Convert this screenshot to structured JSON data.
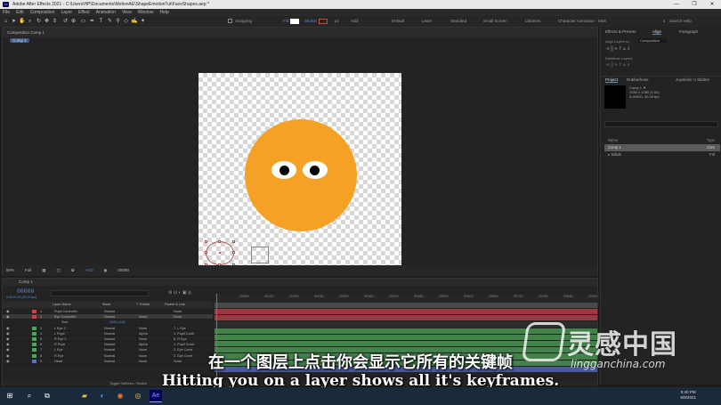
{
  "window": {
    "title": "Adobe After Effects 2021 - C:\\Users\\HP\\Documents\\MotionAE\\ShapeEmotionTut\\FaceShapes.aep *",
    "controls": [
      "—",
      "❐",
      "✕"
    ]
  },
  "menu": [
    "File",
    "Edit",
    "Composition",
    "Layer",
    "Effect",
    "Animation",
    "View",
    "Window",
    "Help"
  ],
  "toolbar": {
    "snapping_label": "Snapping",
    "fill_label": "Fill:",
    "stroke_label": "Stroke:",
    "stroke_value": "px",
    "add_label": "Add:",
    "workspaces": [
      "Default",
      "Learn",
      "Standard",
      "Small Screen",
      "Libraries",
      "Character Animation - Stub"
    ],
    "search_placeholder": "Search Help"
  },
  "composition_panel": {
    "tab_label": "Composition Comp 1",
    "breadcrumb": "Comp 1",
    "zoom": "50%",
    "resolution": "Full",
    "timecode": "00000",
    "exposure": "+0.0"
  },
  "colors": {
    "face": "#f4a125",
    "label_red": "#c8424a",
    "label_green": "#4fa35a",
    "label_blue": "#5a6ec2",
    "timecode": "#5a8cd6"
  },
  "right_panel": {
    "tabs": [
      "Effects & Presets",
      "Align",
      "Paragraph"
    ],
    "align_layers_label": "Align Layers to:",
    "align_target": "Composition",
    "distribute_label": "Distribute Layers:",
    "project_tabs": [
      "Project",
      "Rubberhose",
      "Joysticks 'n Sliders"
    ],
    "project_item": {
      "name": "Comp 1 ▼",
      "size": "1080 x 1080 (1.00)",
      "duration": "Δ 00900, 30.00 fps"
    },
    "project_columns": [
      "Name",
      "Type"
    ],
    "project_rows": [
      {
        "name": "Comp 1",
        "type": "Com"
      },
      {
        "name": "Solids",
        "type": "Fol"
      }
    ]
  },
  "timeline": {
    "tab_label": "Comp 1",
    "timecode": "00000",
    "timecode_sub": "0:00:00:00 (30.00 fps)",
    "columns": [
      "Layer Name",
      "Mode",
      "T TrkMat",
      "Parent & Link"
    ],
    "layers": [
      {
        "num": "1",
        "name": "Pupil Controller",
        "mode": "Normal",
        "trkmat": "",
        "parent": "None",
        "label": "red"
      },
      {
        "num": "2",
        "name": "Eye Controller",
        "mode": "Normal",
        "trkmat": "None",
        "parent": "None",
        "label": "red",
        "selected": true
      },
      {
        "num": "",
        "name": "Size",
        "mode": "",
        "trkmat": "",
        "parent": "",
        "label": "",
        "prop_value": "1060,1140"
      },
      {
        "num": "3",
        "name": "L Eye 2",
        "mode": "Normal",
        "trkmat": "None",
        "parent": "7. L Eye",
        "label": "green"
      },
      {
        "num": "4",
        "name": "L Pupil",
        "mode": "Normal",
        "trkmat": "Alpha",
        "parent": "1. Pupil Contr",
        "label": "green"
      },
      {
        "num": "5",
        "name": "R Eye 2",
        "mode": "Normal",
        "trkmat": "None",
        "parent": "8. R Eye",
        "label": "green"
      },
      {
        "num": "6",
        "name": "R Pupil",
        "mode": "Normal",
        "trkmat": "Alpha",
        "parent": "1. Pupil Contr",
        "label": "green"
      },
      {
        "num": "7",
        "name": "L Eye",
        "mode": "Normal",
        "trkmat": "None",
        "parent": "2. Eye Contr",
        "label": "green"
      },
      {
        "num": "8",
        "name": "R Eye",
        "mode": "Normal",
        "trkmat": "None",
        "parent": "2. Eye Contr",
        "label": "green"
      },
      {
        "num": "9",
        "name": "Head",
        "mode": "Normal",
        "trkmat": "None",
        "parent": "None",
        "label": "blue"
      }
    ],
    "ruler_ticks": [
      "00:00",
      "00030",
      "00060",
      "00090",
      "00120",
      "00150",
      "00180",
      "00210",
      "00240",
      "00270",
      "00300",
      "00330",
      "00360",
      "00390",
      "00420",
      "00450",
      "00480",
      "00510",
      "00540",
      "00570",
      "00600",
      "00630",
      "00660",
      "00690",
      "00720",
      "00750",
      "00780",
      "00810",
      "00840",
      "00870",
      "00900"
    ],
    "footer": "Toggle Switches / Modes"
  },
  "subtitles": {
    "chinese": "在一个图层上点击你会显示它所有的关键帧",
    "english": "Hitting you on a layer shows all it's keyframes."
  },
  "watermark": {
    "chinese": "灵感中国",
    "english": "lingganchina.com"
  },
  "taskbar": {
    "icons": [
      "windows-icon",
      "search-icon",
      "task-view-icon",
      "file-explorer-icon",
      "edge-icon",
      "firefox-icon",
      "chrome-icon",
      "after-effects-icon"
    ],
    "ae_label": "Ae",
    "time": "5:40 PM",
    "date": "6/8/2021"
  }
}
